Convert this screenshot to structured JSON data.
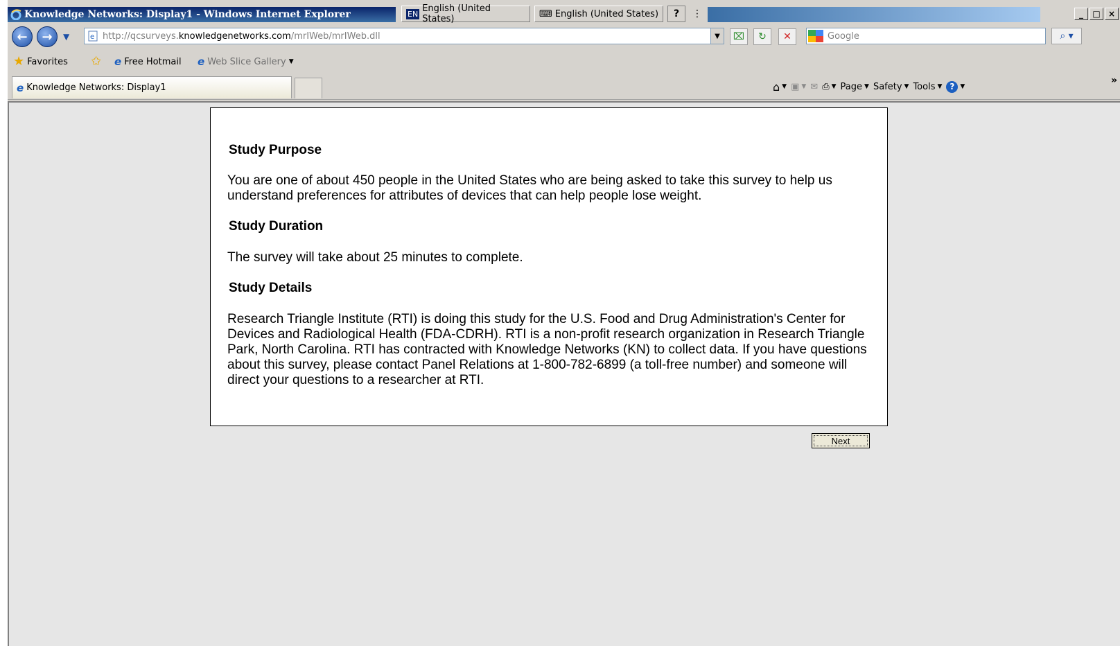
{
  "window": {
    "title": "Knowledge Networks: Display1 - Windows Internet Explorer",
    "language_1": "English (United States)",
    "language_2": "English (United States)",
    "lang_tag": "EN",
    "help_glyph": "?",
    "minimize_glyph": "_",
    "maximize_glyph": "□",
    "close_glyph": "×"
  },
  "navigation": {
    "url_prefix": "http://qcsurveys.",
    "url_host": "knowledgenetworks.com",
    "url_path": "/mrIWeb/mrIWeb.dll",
    "search_placeholder": "Google"
  },
  "favorites": {
    "favorites_label": "Favorites",
    "free_hotmail": "Free Hotmail",
    "web_slice_gallery": "Web Slice Gallery"
  },
  "tabs": [
    {
      "label": "Knowledge Networks: Display1"
    }
  ],
  "command_bar": {
    "page": "Page",
    "safety": "Safety",
    "tools": "Tools"
  },
  "survey": {
    "study_purpose_heading": "Study Purpose",
    "study_purpose_text": "You are one of about 450 people in the United States who are being asked to take this survey to help us understand preferences for attributes of devices that can help people lose weight.",
    "study_duration_heading": "Study Duration",
    "study_duration_text": "The survey will take about 25 minutes to complete.",
    "study_details_heading": "Study Details",
    "study_details_text": "Research Triangle Institute (RTI) is doing this study for the U.S. Food and Drug Administration's Center for Devices and Radiological Health (FDA-CDRH). RTI is a non-profit research organization in Research Triangle Park, North Carolina. RTI has contracted with Knowledge Networks (KN) to collect data. If you have questions about this survey, please contact Panel Relations at 1-800-782-6899 (a toll-free number) and someone will direct your questions to a researcher at RTI.",
    "next_label": "Next"
  },
  "colors": {
    "titlebar_active": "#0a246a",
    "chrome": "#d6d3ce",
    "viewport_bg": "#e6e6e6"
  }
}
